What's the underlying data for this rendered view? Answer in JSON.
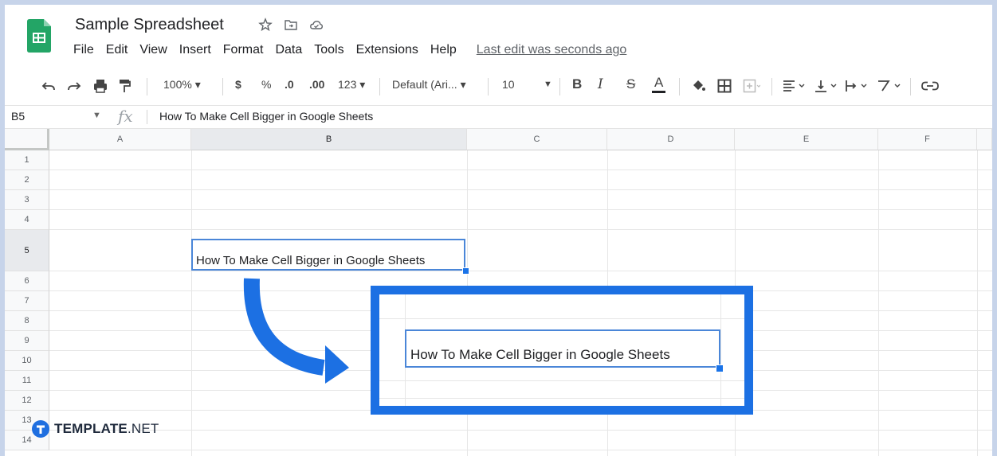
{
  "app": {
    "title": "Sample Spreadsheet",
    "menu": [
      "File",
      "Edit",
      "View",
      "Insert",
      "Format",
      "Data",
      "Tools",
      "Extensions",
      "Help"
    ],
    "last_edit": "Last edit was seconds ago"
  },
  "toolbar": {
    "zoom": "100% ▾",
    "currency": "$",
    "percent": "%",
    "decrease_decimal": ".0",
    "increase_decimal": ".00",
    "more_formats": "123 ▾",
    "font": "Default (Ari... ▾",
    "font_size": "10",
    "bold": "B",
    "italic": "I",
    "strikethrough": "S",
    "text_color": "A"
  },
  "formula_bar": {
    "cell_ref": "B5",
    "fx": "fx",
    "content": "How To Make Cell Bigger in Google Sheets"
  },
  "grid": {
    "columns": [
      "A",
      "B",
      "C",
      "D",
      "E",
      "F"
    ],
    "rows": [
      "1",
      "2",
      "3",
      "4",
      "5",
      "6",
      "7",
      "8",
      "9",
      "10",
      "11",
      "12",
      "13",
      "14"
    ],
    "selected_cell": "B5",
    "cell_b5_text": "How To Make Cell Bigger in Google Sheets"
  },
  "callout": {
    "cell_text": "How To Make Cell Bigger in Google Sheets"
  },
  "watermark": {
    "brand": "TEMPLATE",
    "suffix": ".NET"
  },
  "colors": {
    "accent": "#1c70e3",
    "selection": "#4a86d8",
    "sheets_green": "#0f9d58"
  }
}
